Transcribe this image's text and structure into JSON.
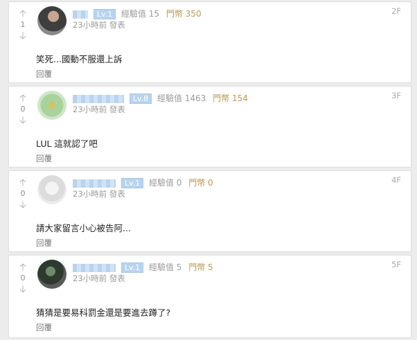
{
  "comments": [
    {
      "votes": "1",
      "level": "Lv.1",
      "exp": "經驗值 15",
      "coin": "門幣 350",
      "time": "23小時前 發表",
      "floor": "2F",
      "text": "笑死...國動不服還上訴",
      "reply": "回覆"
    },
    {
      "votes": "0",
      "level": "Lv.8",
      "exp": "經驗值 1463",
      "coin": "門幣 154",
      "time": "23小時前 發表",
      "floor": "3F",
      "text": "LUL 這就認了吧",
      "reply": "回覆"
    },
    {
      "votes": "0",
      "level": "Lv.1",
      "exp": "經驗值 0",
      "coin": "門幣 0",
      "time": "23小時前 發表",
      "floor": "4F",
      "text": "請大家留言小心被告阿...",
      "reply": "回覆"
    },
    {
      "votes": "0",
      "level": "Lv.1",
      "exp": "經驗值 5",
      "coin": "門幣 5",
      "time": "23小時前 發表",
      "floor": "5F",
      "text": "猜猜是要易科罰金還是要進去蹲了?",
      "reply": "回覆"
    }
  ],
  "icons": {
    "upvote": "arrow-up-icon",
    "downvote": "arrow-down-icon"
  },
  "colors": {
    "level_badge": "#b7d4ee",
    "coin_text": "#b89a53",
    "muted_text": "#9a9a9a"
  }
}
